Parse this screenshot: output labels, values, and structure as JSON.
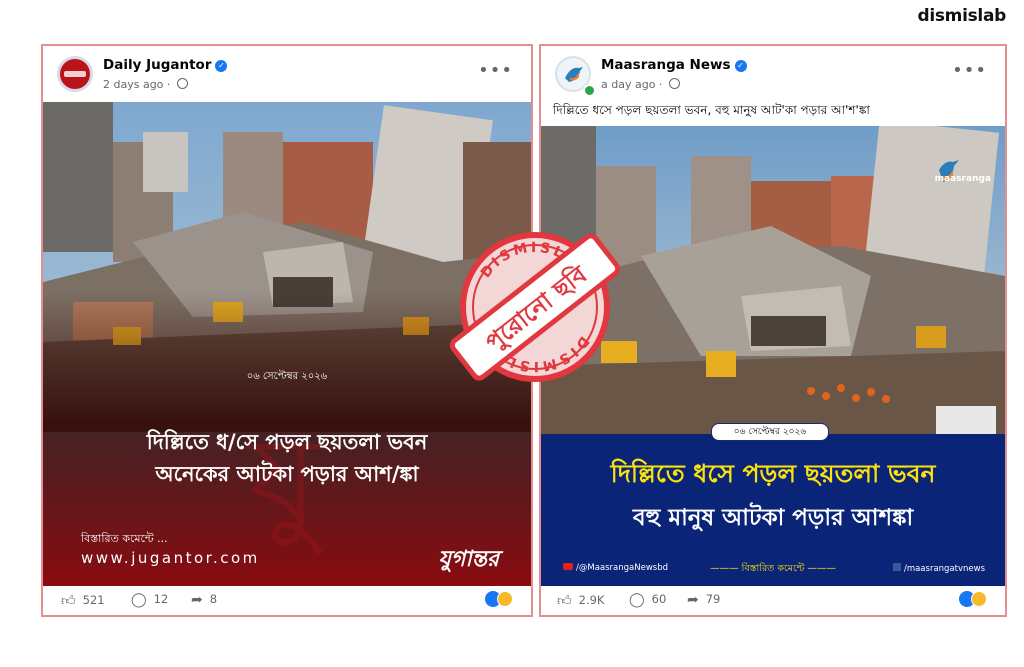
{
  "brand": "dismislab",
  "posts": [
    {
      "page_name": "Daily Jugantor",
      "time": "2 days ago",
      "image": {
        "date": "০৬ সেপ্টেম্বর ২০২৬",
        "headline_1": "দিল্লিতে ধ/সে পড়ল ছয়তলা ভবন",
        "headline_2": "অনেকের আটকা পড়ার আশ/ঙ্কা",
        "more": "বিস্তারিত কমেন্টে ...",
        "website": "www.jugantor.com",
        "logo": "যুগান্তর"
      },
      "likes": "521",
      "comments": "12",
      "shares": "8"
    },
    {
      "page_name": "Maasranga News",
      "time": "a day ago",
      "caption": "দিল্লিতে ধসে পড়ল ছয়তলা ভবন, বহু মানুষ আট'কা পড়ার আ'শ'ঙ্কা",
      "image": {
        "logo": "maasranga",
        "date": "০৬ সেপ্টেম্বর ২০২৬",
        "headline_1": "দিল্লিতে ধসে পড়ল ছয়তলা ভবন",
        "headline_2": "বহু মানুষ আটকা পড়ার আশঙ্কা",
        "youtube": "/@MaasrangaNewsbd",
        "more": "বিস্তারিত কমেন্টে",
        "facebook": "/maasrangatvnews"
      },
      "likes": "2.9K",
      "comments": "60",
      "shares": "79"
    }
  ],
  "stamp": {
    "top": "DISMISLAB",
    "middle": "পুরোনো ছবি",
    "bottom": "DISMISLAB"
  },
  "colors": {
    "frame": "#e48f8f",
    "stamp": "#e0383e",
    "jugantor_red": "#8a0b10",
    "maasranga_blue": "#0a2478"
  }
}
